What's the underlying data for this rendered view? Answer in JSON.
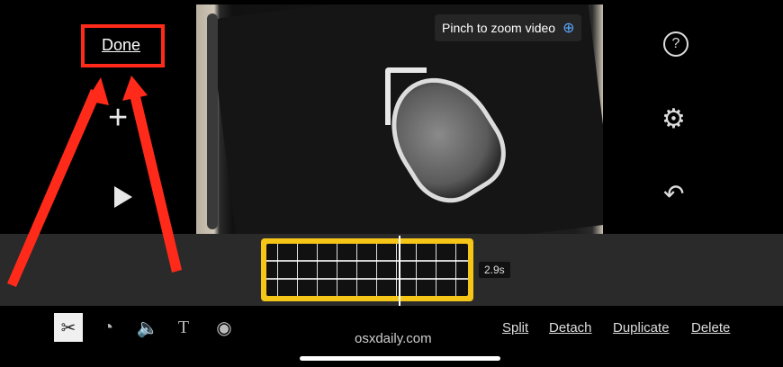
{
  "left_panel": {
    "done_label": "Done"
  },
  "video": {
    "zoom_hint": "Pinch to zoom video"
  },
  "timeline": {
    "clip_duration": "2.9s"
  },
  "toolbar": {
    "tools": [
      "scissors-icon",
      "speed-icon",
      "volume-icon",
      "text-icon",
      "filters-icon"
    ],
    "actions": {
      "split": "Split",
      "detach": "Detach",
      "duplicate": "Duplicate",
      "delete": "Delete"
    }
  },
  "watermark": "osxdaily.com",
  "colors": {
    "annotation": "#ff2a1a",
    "clip": "#f5c518"
  }
}
